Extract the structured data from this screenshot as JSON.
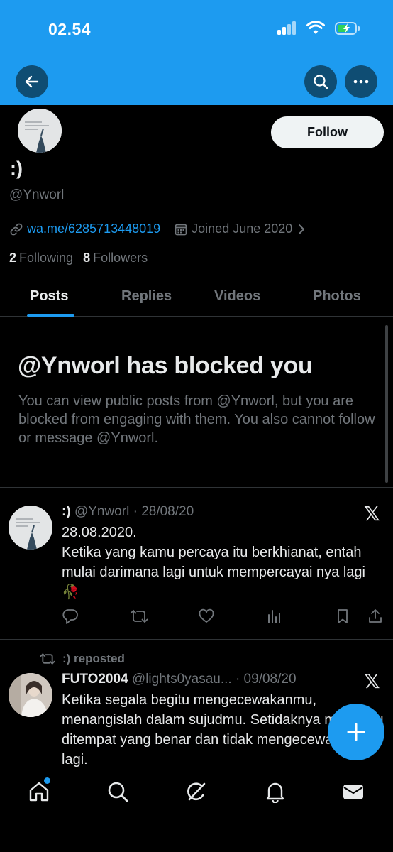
{
  "status_bar": {
    "time": "02.54"
  },
  "profile": {
    "display_name": ":)",
    "handle": "@Ynworl",
    "follow_label": "Follow",
    "link": "wa.me/6285713448019",
    "joined": "Joined June 2020",
    "following_count": "2",
    "following_label": "Following",
    "followers_count": "8",
    "followers_label": "Followers"
  },
  "tabs": [
    "Posts",
    "Replies",
    "Videos",
    "Photos"
  ],
  "blocked": {
    "title": "@Ynworl has blocked you",
    "description": "You can view public posts from @Ynworl, but you are blocked from engaging with them. You also cannot follow or message @Ynworl."
  },
  "posts": [
    {
      "name": ":)",
      "handle": "@Ynworl",
      "date": "· 28/08/20",
      "line1": "28.08.2020.",
      "line2": "Ketika yang kamu percaya itu berkhianat, entah mulai darimana lagi untuk mempercayai nya lagi",
      "emoji": "🥀"
    },
    {
      "repost_label": ":) reposted",
      "name": "FUTO2004",
      "handle": "@lights0yasau...",
      "date": "· 09/08/20",
      "text": "Ketika segala begitu mengecewakanmu, menangislah dalam sujudmu. Setidaknya mengadu ditempat yang benar dan tidak mengecewakanmu lagi."
    }
  ],
  "colors": {
    "accent": "#1d9bf0",
    "background": "#000000",
    "muted": "#71767b",
    "text": "#e7e9ea"
  }
}
